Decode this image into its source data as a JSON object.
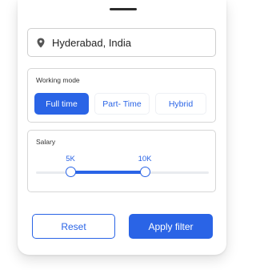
{
  "location": {
    "icon": "map-pin-icon",
    "value": "Hyderabad, India"
  },
  "working_mode": {
    "title": "Working mode",
    "options": [
      "Full time",
      "Part- Time",
      "Hybrid"
    ],
    "selected": "Full time"
  },
  "salary": {
    "title": "Salary",
    "min_label": "5K",
    "max_label": "10K",
    "range_min_fraction": 0.2,
    "range_max_fraction": 0.63
  },
  "actions": {
    "reset_label": "Reset",
    "apply_label": "Apply filter"
  },
  "colors": {
    "accent": "#2a64e6",
    "border": "#d6d6d6",
    "track": "#e9ebef"
  }
}
